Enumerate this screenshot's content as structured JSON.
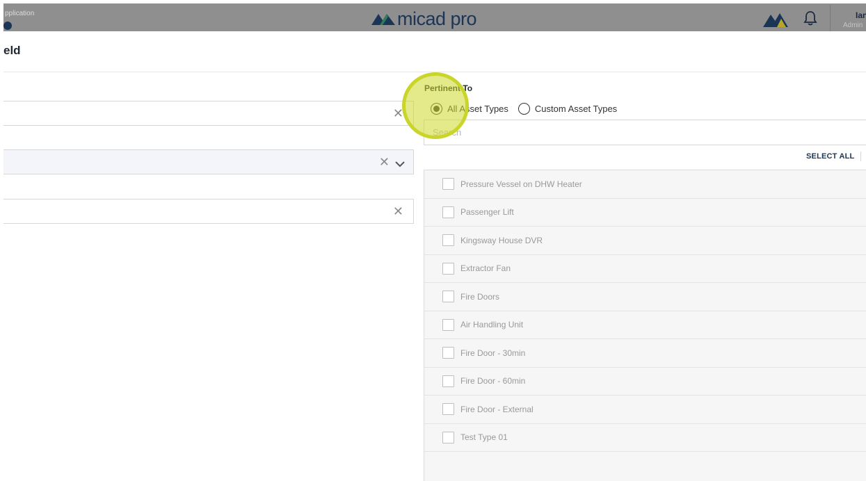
{
  "header": {
    "app_label": "pplication",
    "logo_text": "micad pro",
    "user_name": "Ian",
    "user_role": "Admin"
  },
  "page": {
    "title": "eld"
  },
  "form": {
    "field1": {
      "value": "",
      "clear_icon": "close-icon"
    },
    "field2": {
      "value": "",
      "clear_icon": "close-icon",
      "dropdown_icon": "chevron-down-icon"
    },
    "field3": {
      "value": "",
      "clear_icon": "close-icon"
    }
  },
  "pertinent_to": {
    "label": "Pertinent To",
    "options": [
      "All Asset Types",
      "Custom Asset Types"
    ],
    "selected": "All Asset Types"
  },
  "search": {
    "placeholder": "Search"
  },
  "select_all_label": "SELECT ALL",
  "asset_types": [
    "Pressure Vessel on DHW Heater",
    "Passenger Lift",
    "Kingsway House DVR",
    "Extractor Fan",
    "Fire Doors",
    "Air Handling Unit",
    "Fire Door - 30min",
    "Fire Door - 60min",
    "Fire Door - External",
    "Test Type 01"
  ],
  "colors": {
    "brand_navy": "#1b3557",
    "brand_green": "#2e7d5b",
    "highlight": "#c9d52a"
  }
}
